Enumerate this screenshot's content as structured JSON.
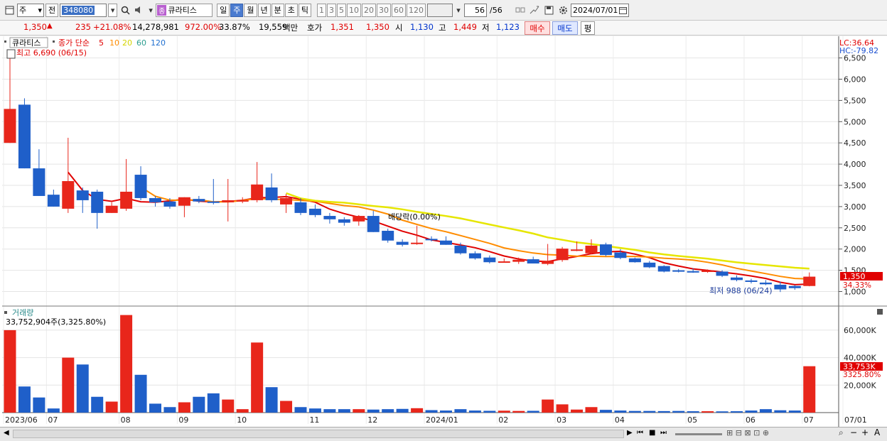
{
  "toolbar": {
    "market": "주",
    "prev": "전",
    "code": "348080",
    "name_badge": "종",
    "name": "큐라티스",
    "periods": [
      {
        "label": "일",
        "active": false
      },
      {
        "label": "주",
        "active": true
      },
      {
        "label": "월",
        "active": false
      },
      {
        "label": "년",
        "active": false
      },
      {
        "label": "분",
        "active": false
      },
      {
        "label": "초",
        "active": false
      },
      {
        "label": "틱",
        "active": false
      }
    ],
    "intervals": [
      "1",
      "3",
      "5",
      "10",
      "20",
      "30",
      "60",
      "120"
    ],
    "count": "56",
    "total": "/56",
    "date": "2024/07/01"
  },
  "quote": {
    "price": "1,350",
    "arrow": "▲",
    "change": "235",
    "change_pct": "+21.08%",
    "volume": "14,278,981",
    "volume_pct": "972.00%",
    "turnover_pct": "33.87%",
    "amount": "19,559",
    "amount_unit": "백만",
    "bid_label": "호가",
    "bid1": "1,351",
    "bid2": "1,350",
    "open_label": "시",
    "open": "1,130",
    "high_label": "고",
    "high": "1,449",
    "low_label": "저",
    "low": "1,123",
    "buy_button": "매수",
    "sell_button": "매도",
    "eval_button": "평"
  },
  "chart_data": {
    "type": "candlestick",
    "legend": {
      "stock": "큐라티스",
      "ma_label": "종가 단순",
      "periods": [
        "5",
        "10",
        "20",
        "60",
        "120"
      ],
      "colors": [
        "#e00000",
        "#ff8c00",
        "#e6e600",
        "#2a9d8f",
        "#1f6fd0"
      ]
    },
    "lc": "LC:36.64",
    "hc": "HC:-79.82",
    "high_marker": "최고 6,690 (06/15)",
    "low_marker": "최저 988 (06/24)",
    "dividend_note": "배당락(0.00%)",
    "last_price_label": "1,350",
    "last_change_label": "34.33%",
    "ylim": [
      880,
      6690
    ],
    "y_ticks": [
      "1,000",
      "1,500",
      "2,000",
      "2,500",
      "3,000",
      "3,500",
      "4,000",
      "4,500",
      "5,000",
      "5,500",
      "6,000",
      "6,500"
    ],
    "x_tick_labels": [
      "2023/06",
      "07",
      "08",
      "09",
      "10",
      "11",
      "12",
      "2024/01",
      "02",
      "03",
      "04",
      "05",
      "06",
      "07",
      "07/01"
    ],
    "ohlc": [
      [
        4500,
        6690,
        4500,
        5300
      ],
      [
        5400,
        5550,
        3900,
        3900
      ],
      [
        3900,
        4350,
        3250,
        3250
      ],
      [
        3280,
        3400,
        3000,
        3000
      ],
      [
        2950,
        4620,
        2850,
        3600
      ],
      [
        3380,
        3450,
        2850,
        3150
      ],
      [
        3350,
        3400,
        2480,
        2850
      ],
      [
        2850,
        3100,
        2850,
        3020
      ],
      [
        2950,
        4120,
        2900,
        3350
      ],
      [
        3750,
        3950,
        3150,
        3200
      ],
      [
        3200,
        3250,
        3000,
        3100
      ],
      [
        3120,
        3200,
        2950,
        3000
      ],
      [
        3020,
        3220,
        2750,
        3220
      ],
      [
        3180,
        3250,
        3080,
        3120
      ],
      [
        3120,
        3650,
        3050,
        3100
      ],
      [
        3100,
        3650,
        2650,
        3150
      ],
      [
        3150,
        3220,
        3080,
        3150
      ],
      [
        3150,
        4050,
        3100,
        3520
      ],
      [
        3450,
        3780,
        3100,
        3150
      ],
      [
        3050,
        3300,
        2850,
        3200
      ],
      [
        3100,
        3200,
        2800,
        2850
      ],
      [
        2950,
        3050,
        2750,
        2800
      ],
      [
        2780,
        2850,
        2600,
        2700
      ],
      [
        2700,
        2750,
        2550,
        2620
      ],
      [
        2650,
        2800,
        2550,
        2780
      ],
      [
        2780,
        2900,
        2400,
        2400
      ],
      [
        2430,
        2480,
        2150,
        2200
      ],
      [
        2170,
        2230,
        2060,
        2100
      ],
      [
        2150,
        2550,
        2100,
        2150
      ],
      [
        2240,
        2300,
        2180,
        2230
      ],
      [
        2200,
        2300,
        2100,
        2100
      ],
      [
        2080,
        2150,
        1870,
        1900
      ],
      [
        1900,
        1950,
        1750,
        1780
      ],
      [
        1800,
        1850,
        1660,
        1690
      ],
      [
        1700,
        1780,
        1680,
        1710
      ],
      [
        1700,
        1800,
        1650,
        1750
      ],
      [
        1760,
        1820,
        1660,
        1660
      ],
      [
        1650,
        2120,
        1620,
        1720
      ],
      [
        1740,
        2050,
        1700,
        2010
      ],
      [
        1980,
        2180,
        1950,
        1990
      ],
      [
        1900,
        2230,
        1880,
        2080
      ],
      [
        2110,
        2150,
        1830,
        1860
      ],
      [
        1920,
        2000,
        1760,
        1790
      ],
      [
        1780,
        1800,
        1680,
        1690
      ],
      [
        1680,
        1720,
        1550,
        1570
      ],
      [
        1600,
        1620,
        1450,
        1470
      ],
      [
        1500,
        1530,
        1450,
        1480
      ],
      [
        1480,
        1550,
        1440,
        1460
      ],
      [
        1460,
        1520,
        1440,
        1500
      ],
      [
        1470,
        1500,
        1340,
        1370
      ],
      [
        1330,
        1380,
        1240,
        1270
      ],
      [
        1260,
        1300,
        1190,
        1230
      ],
      [
        1210,
        1270,
        1150,
        1170
      ],
      [
        1160,
        1230,
        988,
        1050
      ],
      [
        1130,
        1150,
        1040,
        1080
      ],
      [
        1130,
        1449,
        1123,
        1350
      ]
    ],
    "volume_label": "거래량",
    "volume_value": "33,752,904주(3,325.80%)",
    "volume_ticks": [
      "20,000K",
      "40,000K",
      "60,000K"
    ],
    "volume_last_label": "33,753K",
    "volume_last_pct": "3325.80%",
    "volume_k": [
      60000,
      19000,
      11000,
      3000,
      40000,
      35000,
      11500,
      8000,
      71000,
      27500,
      6500,
      4000,
      7500,
      11500,
      14000,
      9500,
      2500,
      51000,
      18500,
      8500,
      4000,
      3000,
      2500,
      2500,
      2500,
      2200,
      2500,
      2700,
      3200,
      1800,
      1500,
      2500,
      1500,
      1300,
      1400,
      1200,
      1300,
      9500,
      6000,
      2200,
      4000,
      2000,
      1500,
      1200,
      1200,
      1100,
      1200,
      1000,
      1000,
      900,
      1000,
      1500,
      2500,
      1700,
      1500,
      33753
    ]
  }
}
